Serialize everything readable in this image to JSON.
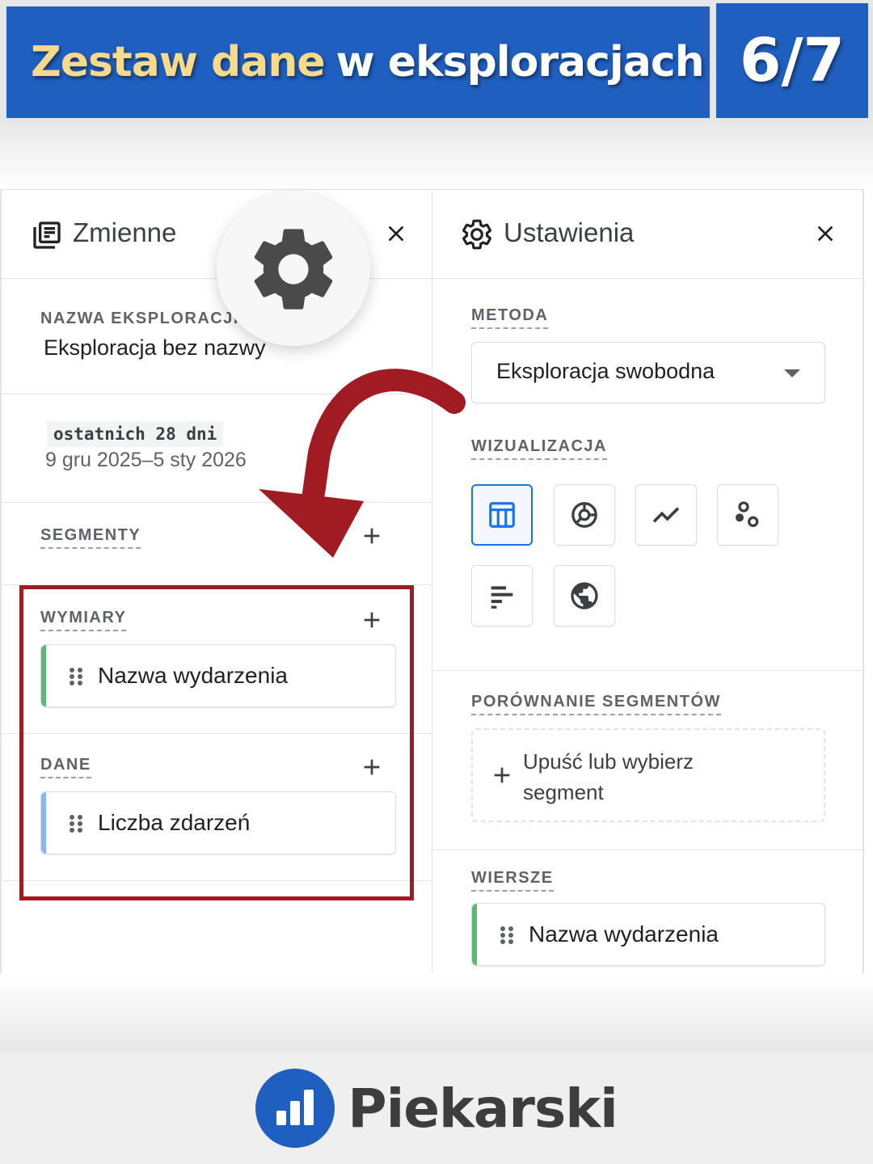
{
  "banner": {
    "title_highlight": "Zestaw dane",
    "title_rest": "w eksploracjach",
    "page_indicator": "6/7"
  },
  "variables_panel": {
    "title": "Zmienne",
    "exploration_name_label": "NAZWA EKSPLORACJI",
    "exploration_name_value": "Eksploracja bez nazwy",
    "date_range_badge": "ostatnich 28 dni",
    "date_range_value": "9 gru 2025–5 sty 2026",
    "segments_label": "SEGMENTY",
    "dimensions_label": "WYMIARY",
    "dimensions": [
      "Nazwa wydarzenia"
    ],
    "metrics_label": "DANE",
    "metrics": [
      "Liczba zdarzeń"
    ]
  },
  "settings_panel": {
    "title": "Ustawienia",
    "method_label": "METODA",
    "method_value": "Eksploracja swobodna",
    "visualization_label": "WIZUALIZACJA",
    "visualizations": [
      {
        "icon": "table-icon",
        "active": true
      },
      {
        "icon": "donut-chart-icon",
        "active": false
      },
      {
        "icon": "line-chart-icon",
        "active": false
      },
      {
        "icon": "scatter-plot-icon",
        "active": false
      },
      {
        "icon": "bar-chart-icon",
        "active": false
      },
      {
        "icon": "globe-icon",
        "active": false
      }
    ],
    "segment_comparison_label": "PORÓWNANIE SEGMENTÓW",
    "segment_drop_text": "Upuść lub wybierz segment",
    "rows_label": "WIERSZE",
    "rows": [
      "Nazwa wydarzenia"
    ]
  },
  "footer": {
    "brand_name": "Piekarski"
  },
  "colors": {
    "banner_blue": "#1f5fc0",
    "highlight_yellow": "#f9d98a",
    "annotation_red": "#a01c22",
    "dimension_accent": "#5bb974",
    "metric_accent": "#8ab4f8",
    "active_blue": "#1a73e8"
  }
}
